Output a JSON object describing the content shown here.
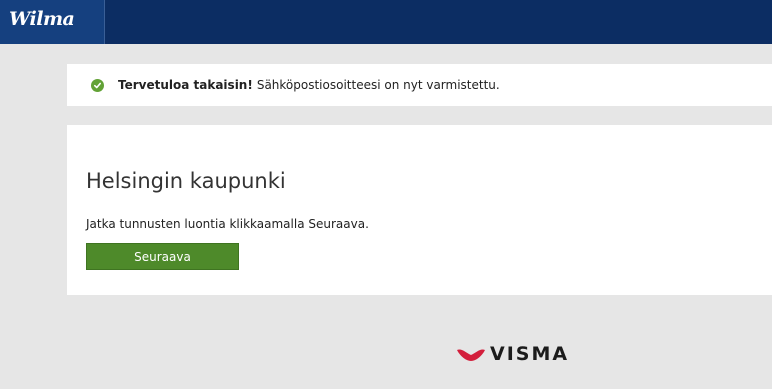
{
  "header": {
    "logo_text": "Wilma"
  },
  "notice": {
    "icon": "check-circle-icon",
    "bold_text": "Tervetuloa takaisin!",
    "text": "Sähköpostiosoitteesi on nyt varmistettu."
  },
  "card": {
    "title": "Helsingin kaupunki",
    "instruction": "Jatka tunnusten luontia klikkaamalla Seuraava.",
    "next_button_label": "Seuraava"
  },
  "footer": {
    "brand_text": "VISMA"
  },
  "colors": {
    "header_bg": "#0c2d63",
    "success_green": "#62a236",
    "button_green": "#4e8a2a",
    "visma_red": "#d31f3c"
  }
}
